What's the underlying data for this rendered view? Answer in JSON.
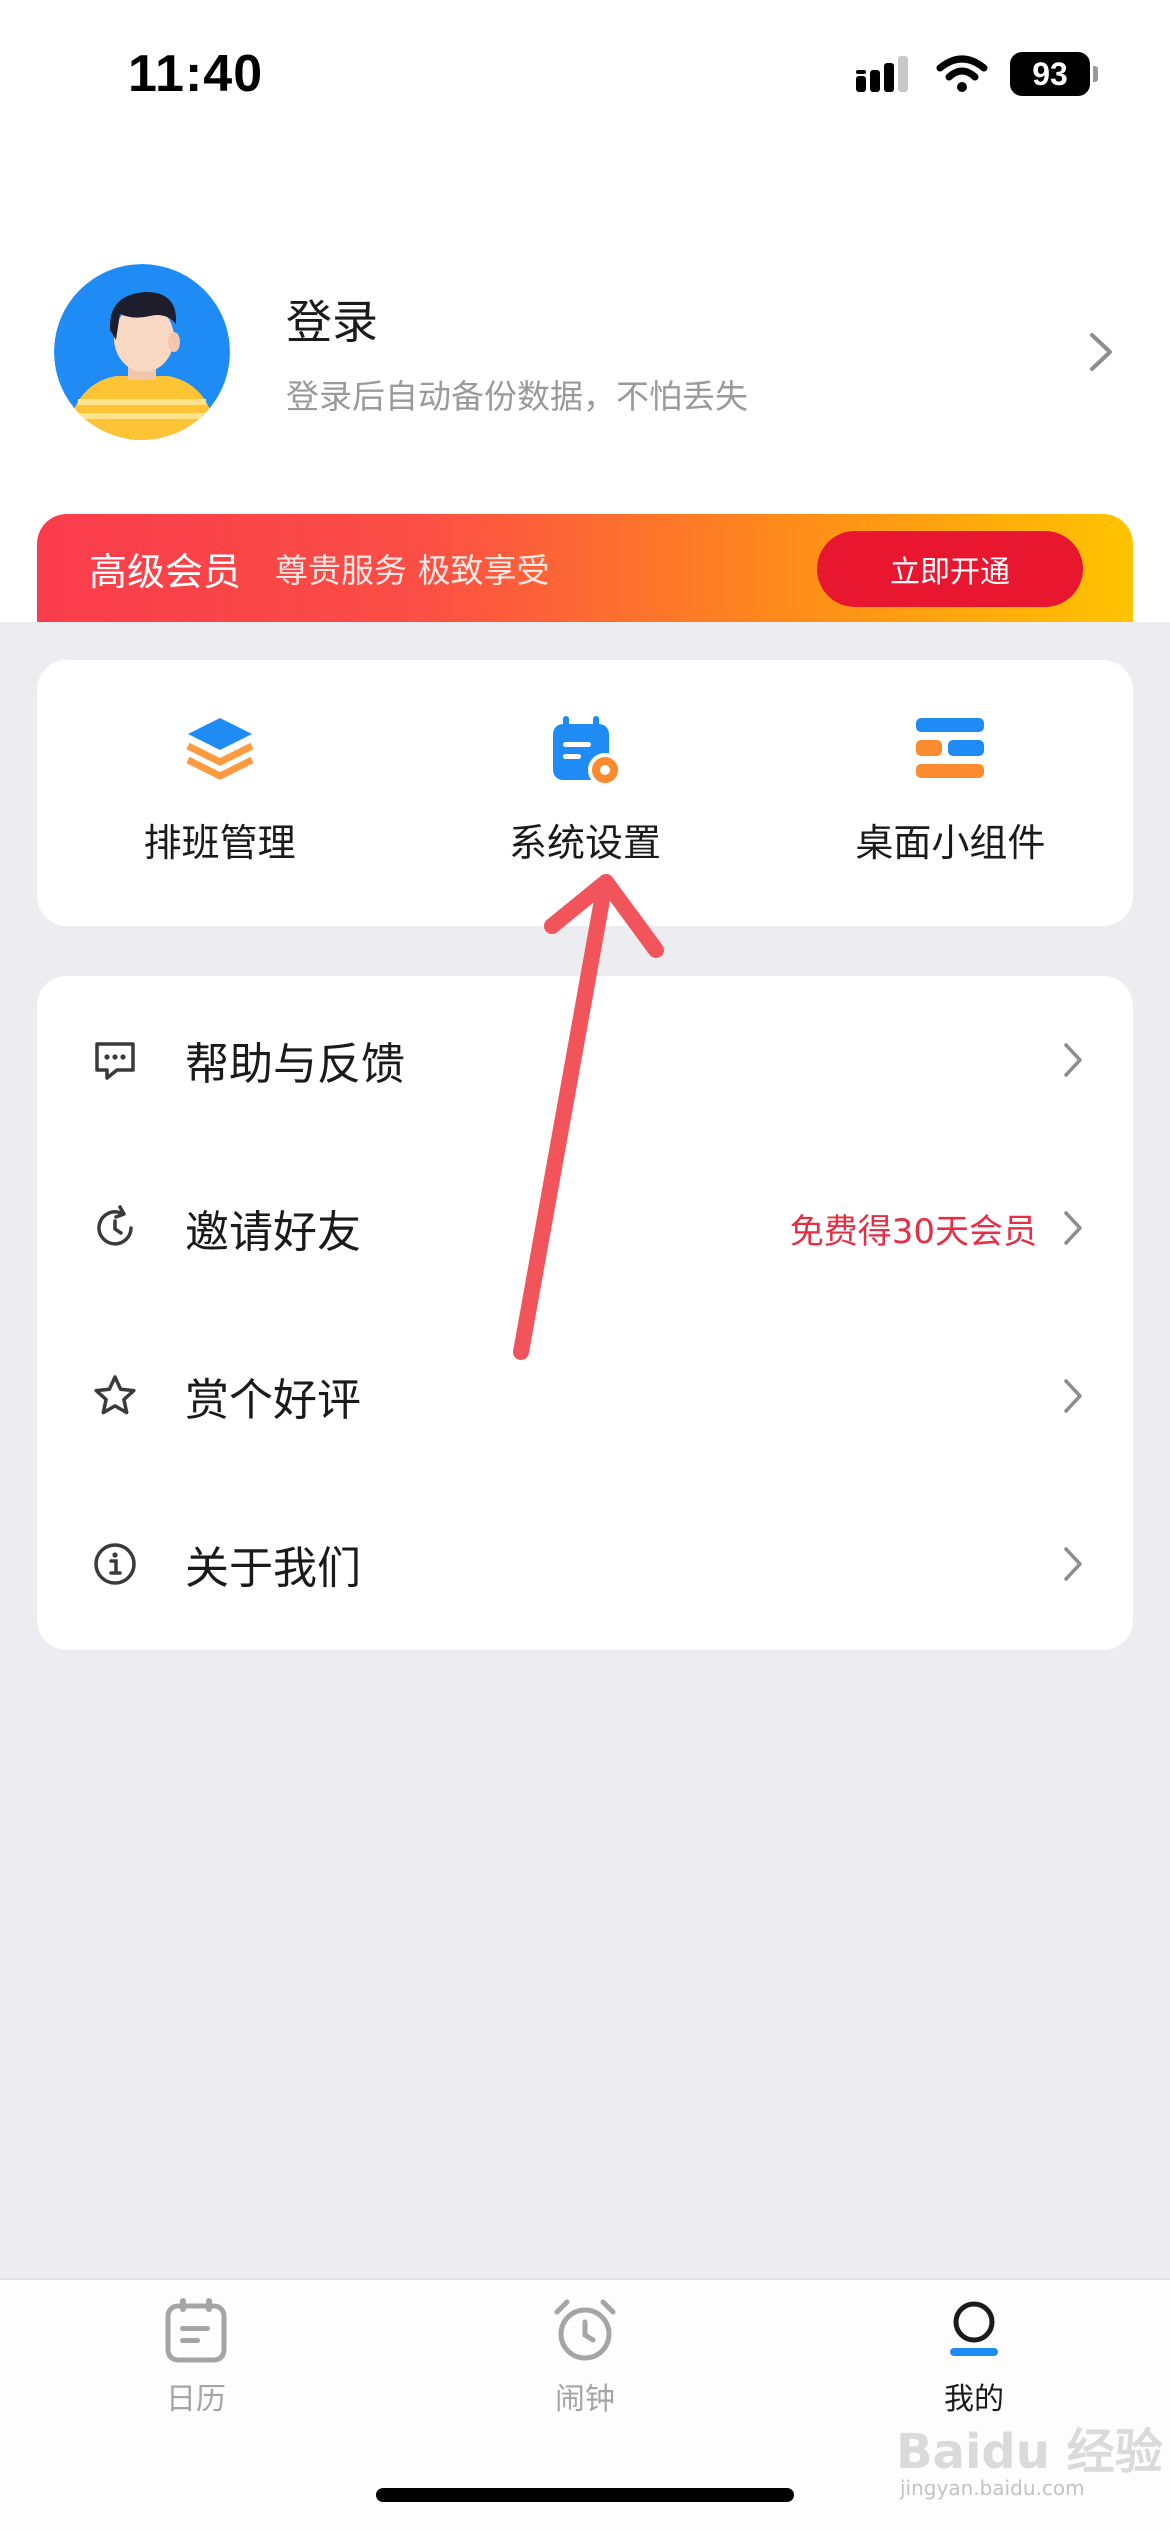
{
  "status_bar": {
    "time": "11:40",
    "battery": "93"
  },
  "profile": {
    "title": "登录",
    "subtitle": "登录后自动备份数据，不怕丢失"
  },
  "vip": {
    "title": "高级会员",
    "desc": "尊贵服务 极致享受",
    "button": "立即开通"
  },
  "quick_grid": [
    {
      "label": "排班管理",
      "icon": "layers-icon"
    },
    {
      "label": "系统设置",
      "icon": "calendar-settings-icon"
    },
    {
      "label": "桌面小组件",
      "icon": "widget-icon"
    }
  ],
  "menu": [
    {
      "label": "帮助与反馈",
      "icon": "chat-bubble-icon",
      "extra": ""
    },
    {
      "label": "邀请好友",
      "icon": "refresh-icon",
      "extra": "免费得30天会员"
    },
    {
      "label": "赏个好评",
      "icon": "star-icon",
      "extra": ""
    },
    {
      "label": "关于我们",
      "icon": "info-icon",
      "extra": ""
    }
  ],
  "tabs": [
    {
      "label": "日历",
      "icon": "calendar-icon",
      "active": false
    },
    {
      "label": "闹钟",
      "icon": "alarm-clock-icon",
      "active": false
    },
    {
      "label": "我的",
      "icon": "user-icon",
      "active": true
    }
  ],
  "watermark": {
    "text": "Baidu 经验",
    "sub": "jingyan.baidu.com"
  },
  "colors": {
    "accent_blue": "#1f8cf5",
    "accent_orange": "#fb8b2e",
    "vip_button": "#e8162f",
    "promo_text": "#e62e45",
    "annotation_arrow": "#f2545b"
  }
}
